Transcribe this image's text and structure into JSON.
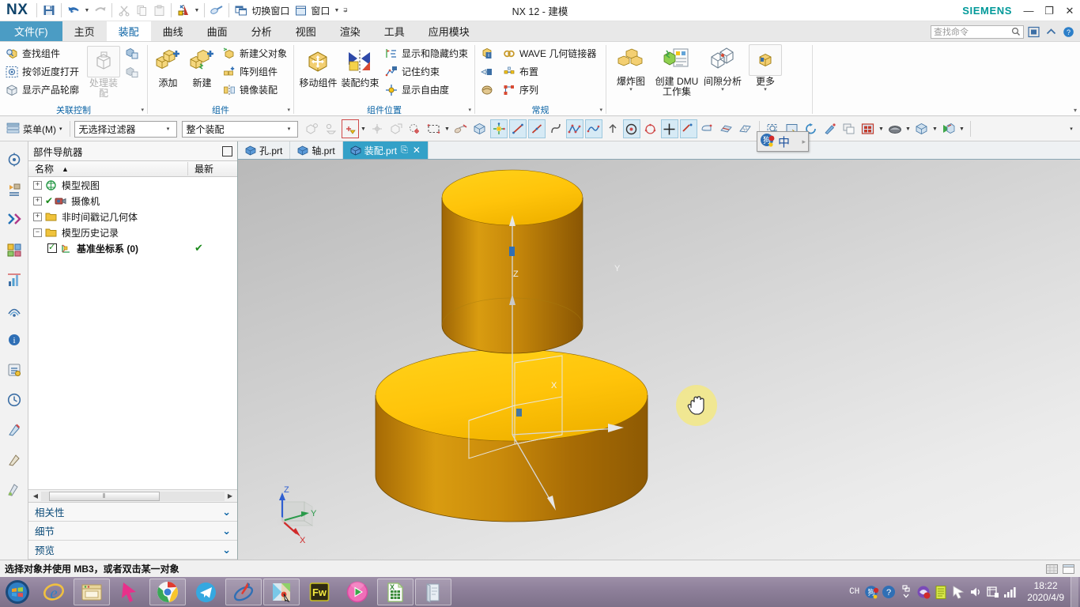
{
  "window": {
    "title": "NX 12 - 建模",
    "brand": "SIEMENS",
    "logo": "NX",
    "minimize": "—",
    "restore": "❐",
    "close": "✕"
  },
  "quick_access": [
    {
      "name": "save-button",
      "icon": "save-icon"
    },
    {
      "name": "undo-button",
      "icon": "undo-icon",
      "caret": "▾"
    },
    {
      "name": "redo-button",
      "icon": "redo-icon"
    },
    {
      "name": "cut-button",
      "icon": "scissors-icon"
    },
    {
      "name": "copy-button",
      "icon": "copy-icon"
    },
    {
      "name": "paste-button",
      "icon": "paste-icon"
    },
    {
      "name": "undo-list-button",
      "icon": "color-marker-icon",
      "caret": "▾"
    },
    {
      "name": "paint-button",
      "icon": "eraser-icon"
    }
  ],
  "quick_access_text": [
    {
      "label": "切换窗口",
      "icon": "switch-window-icon"
    },
    {
      "label": "窗口",
      "icon": "window-icon",
      "caret": "▾"
    }
  ],
  "quick_access_overflow": "⋥",
  "ribbon": {
    "tabs": [
      {
        "label": "文件(F)",
        "type": "file"
      },
      {
        "label": "主页",
        "type": "normal"
      },
      {
        "label": "装配",
        "type": "active"
      },
      {
        "label": "曲线",
        "type": "normal"
      },
      {
        "label": "曲面",
        "type": "normal"
      },
      {
        "label": "分析",
        "type": "normal"
      },
      {
        "label": "视图",
        "type": "normal"
      },
      {
        "label": "渲染",
        "type": "normal"
      },
      {
        "label": "工具",
        "type": "normal"
      },
      {
        "label": "应用模块",
        "type": "normal"
      }
    ],
    "search": {
      "placeholder": "查找命令",
      "icon": "search-icon"
    },
    "right_icons": [
      {
        "name": "fullscreen-icon",
        "glyph": "▣"
      },
      {
        "name": "collapse-ribbon-icon",
        "glyph": "⌃"
      },
      {
        "name": "help-icon",
        "glyph": "?"
      }
    ],
    "groups": [
      {
        "label": "关联控制",
        "dialog_launcher": "▾",
        "small_items": [
          {
            "label": "查找组件",
            "icon": "find-component-icon"
          },
          {
            "label": "按邻近度打开",
            "icon": "open-by-proximity-icon"
          },
          {
            "label": "显示产品轮廓",
            "icon": "show-product-outline-icon"
          }
        ],
        "big_items": [
          {
            "label": "处理装配",
            "icon": "process-assembly-icon",
            "disabled": true
          }
        ],
        "icon_column": [
          {
            "icon": "wave-copy-icon"
          },
          {
            "icon": "wave-link-icon"
          }
        ]
      },
      {
        "label": "组件",
        "dialog_launcher": "▾",
        "big_items": [
          {
            "label": "添加",
            "icon": "add-component-icon"
          },
          {
            "label": "新建",
            "icon": "new-component-icon"
          }
        ],
        "small_items": [
          {
            "label": "新建父对象",
            "icon": "new-parent-icon"
          },
          {
            "label": "阵列组件",
            "icon": "pattern-component-icon"
          },
          {
            "label": "镜像装配",
            "icon": "mirror-assembly-icon"
          }
        ]
      },
      {
        "label": "组件位置",
        "dialog_launcher": "▾",
        "big_items": [
          {
            "label": "移动组件",
            "icon": "move-component-icon"
          },
          {
            "label": "装配约束",
            "icon": "assembly-constraint-icon"
          }
        ],
        "small_items": [
          {
            "label": "显示和隐藏约束",
            "icon": "show-hide-constraints-icon"
          },
          {
            "label": "记住约束",
            "icon": "remember-constraint-icon"
          },
          {
            "label": "显示自由度",
            "icon": "show-dof-icon"
          }
        ]
      },
      {
        "label": "常规",
        "dialog_launcher": "▾",
        "icon_column": [
          {
            "icon": "assembly-report-icon"
          },
          {
            "icon": "assembly-cut-icon"
          },
          {
            "icon": "assembly-weld-icon"
          }
        ],
        "small_items": [
          {
            "label": "WAVE 几何链接器",
            "icon": "wave-geometry-linker-icon"
          },
          {
            "label": "布置",
            "icon": "arrangement-icon"
          },
          {
            "label": "序列",
            "icon": "sequence-icon"
          }
        ]
      },
      {
        "label": "",
        "big_items": [
          {
            "label": "爆炸图",
            "icon": "exploded-view-icon",
            "caret": "▾"
          },
          {
            "label": "创建 DMU 工作集",
            "icon": "create-dmu-icon"
          },
          {
            "label": "间隙分析",
            "icon": "clearance-analysis-icon",
            "caret": "▾"
          },
          {
            "label": "更多",
            "icon": "more-icon",
            "caret": "▾",
            "boxed": true
          }
        ]
      }
    ],
    "collapse_glyph": "▾"
  },
  "selection_toolbar": {
    "menu": {
      "label": "菜单(M)",
      "caret": "▾",
      "icon": "menu-icon"
    },
    "filter_combo": {
      "value": "无选择过滤器",
      "caret": "▾"
    },
    "scope_combo": {
      "value": "整个装配",
      "caret": "▾"
    },
    "buttons": [
      {
        "name": "select-general-icon",
        "state": "disabled"
      },
      {
        "name": "select-feature-icon",
        "state": "disabled"
      },
      {
        "name": "snap-point-icon",
        "state": "highlight",
        "caret": "▾"
      },
      {
        "name": "point-dialog-icon",
        "state": "disabled"
      },
      {
        "name": "select-face-icon",
        "state": "disabled"
      },
      {
        "name": "face-snap-icon",
        "state": "normal"
      },
      {
        "name": "rectangle-select-icon",
        "state": "normal",
        "caret": "▾"
      },
      {
        "name": "sketch-in-task-icon",
        "state": "normal"
      },
      {
        "name": "solid-body-icon",
        "state": "normal"
      },
      {
        "name": "datum-csys-icon",
        "state": "selected"
      },
      {
        "name": "line-icon",
        "state": "selected"
      },
      {
        "name": "line2-icon",
        "state": "selected"
      },
      {
        "name": "spline-curve-icon",
        "state": "normal"
      },
      {
        "name": "studio-spline-icon",
        "state": "selected"
      },
      {
        "name": "curve-fit-icon",
        "state": "selected"
      },
      {
        "name": "helix-icon",
        "state": "normal"
      },
      {
        "name": "circle-center-icon",
        "state": "selected"
      },
      {
        "name": "arc-icon",
        "state": "normal"
      },
      {
        "name": "point-icon",
        "state": "selected"
      },
      {
        "name": "datum-plane-icon",
        "state": "selected"
      },
      {
        "name": "extrude-icon",
        "state": "normal"
      },
      {
        "name": "patch-icon",
        "state": "normal"
      },
      {
        "name": "mesh-surface-icon",
        "state": "normal"
      }
    ],
    "view_buttons": [
      {
        "name": "fit-view-icon"
      },
      {
        "name": "zoom-window-icon"
      },
      {
        "name": "rotate-view-icon"
      },
      {
        "name": "pan-view-icon"
      },
      {
        "name": "layout-view-icon"
      },
      {
        "name": "shaded-style-icon",
        "caret": "▾"
      },
      {
        "name": "render-style-icon",
        "caret": "▾"
      },
      {
        "name": "orient-view-icon",
        "caret": "▾"
      },
      {
        "name": "visibility-icon",
        "caret": "▾"
      }
    ],
    "overflow": "▾"
  },
  "resource_bar": [
    {
      "name": "assembly-navigator-icon"
    },
    {
      "name": "constraint-navigator-icon"
    },
    {
      "name": "part-navigator-icon"
    },
    {
      "name": "reuse-library-icon"
    },
    {
      "name": "hd3d-tools-icon"
    },
    {
      "name": "web-browser-icon"
    },
    {
      "name": "history-icon"
    },
    {
      "name": "process-studio-icon"
    },
    {
      "name": "roles-icon"
    },
    {
      "name": "system-materials-icon"
    }
  ],
  "navigator": {
    "title": "部件导航器",
    "pin_icon": "pin-icon",
    "columns": [
      {
        "label": "名称",
        "sort": "▲"
      },
      {
        "label": "最新"
      }
    ],
    "rows": [
      {
        "label": "模型视图",
        "expander": "+",
        "icon": "model-views-icon",
        "level": 0,
        "check": false,
        "status": ""
      },
      {
        "label": "摄像机",
        "expander": "+",
        "icon": "cameras-icon",
        "level": 0,
        "check": false,
        "status": "",
        "mark": "✔"
      },
      {
        "label": "非时间戳记几何体",
        "expander": "+",
        "icon": "folder-icon",
        "level": 0,
        "check": false,
        "status": ""
      },
      {
        "label": "模型历史记录",
        "expander": "−",
        "icon": "folder-icon",
        "level": 0,
        "check": false,
        "status": ""
      },
      {
        "label": "基准坐标系 (0)",
        "expander": "",
        "icon": "datum-csys-small-icon",
        "level": 1,
        "check": true,
        "status": "✔"
      }
    ],
    "hscroll": {
      "left": "◀",
      "right": "▶",
      "grip": "⦀"
    },
    "sections": [
      {
        "label": "相关性",
        "chevron": "⌄"
      },
      {
        "label": "细节",
        "chevron": "⌄"
      },
      {
        "label": "预览",
        "chevron": "⌄"
      }
    ]
  },
  "document_tabs": [
    {
      "label": "孔.prt",
      "icon": "part-file-icon",
      "active": false
    },
    {
      "label": "轴.prt",
      "icon": "part-file-icon",
      "active": false
    },
    {
      "label": "装配.prt",
      "icon": "part-file-icon",
      "active": true,
      "modified": "⎘",
      "close": "✕"
    }
  ],
  "viewport": {
    "csys": {
      "x_label": "X",
      "y_label": "Y",
      "z_label": "Z"
    },
    "wcs_triad": {
      "x_label": "X",
      "y_label": "Y",
      "z_label": "Z"
    },
    "model_color_top": "#FFC709",
    "model_color_side": "#C07A0A",
    "cursor": "pan-hand-cursor"
  },
  "ime": {
    "lang": "中",
    "icon": "ime-globe-icon",
    "arrow": "▸"
  },
  "status_bar": {
    "message": "选择对象并使用 MB3，或者双击某一对象",
    "icons": [
      {
        "name": "status-grid-icon"
      },
      {
        "name": "status-window-icon"
      }
    ]
  },
  "taskbar": {
    "start": "start-orb-icon",
    "items": [
      {
        "name": "internet-explorer-icon"
      },
      {
        "name": "file-explorer-icon",
        "boxed": true
      },
      {
        "name": "pink-cursor-app-icon"
      },
      {
        "name": "google-chrome-icon",
        "boxed": true
      },
      {
        "name": "telegram-icon"
      },
      {
        "name": "nx-app-icon",
        "boxed": true
      },
      {
        "name": "paint-app-icon",
        "boxed": true
      },
      {
        "name": "fireworks-icon"
      },
      {
        "name": "media-player-icon"
      },
      {
        "name": "excel-icon",
        "boxed": true
      },
      {
        "name": "notepad-app-icon",
        "boxed": true
      }
    ],
    "tray": {
      "lang": "CH",
      "items": [
        {
          "name": "sogou-ime-icon"
        },
        {
          "name": "help-tray-icon"
        },
        {
          "name": "show-hidden-icon"
        },
        {
          "name": "antivirus-icon"
        },
        {
          "name": "notes-icon"
        },
        {
          "name": "pointer-icon"
        },
        {
          "name": "volume-icon"
        },
        {
          "name": "action-center-icon"
        },
        {
          "name": "network-icon"
        }
      ],
      "time": "18:22",
      "date": "2020/4/9"
    }
  }
}
